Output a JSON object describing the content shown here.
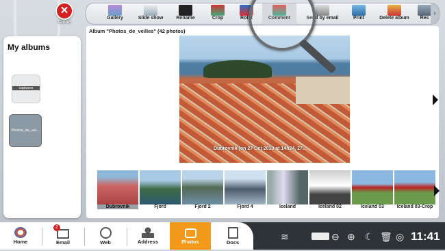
{
  "close": {
    "label": "Close"
  },
  "toolbar": {
    "tools": [
      {
        "label": "Gallery"
      },
      {
        "label": "Slide show"
      },
      {
        "label": "Rename"
      },
      {
        "label": "Crop"
      },
      {
        "label": "Rotat"
      },
      {
        "label": "Comment"
      },
      {
        "label": "Send by email"
      },
      {
        "label": "Print"
      },
      {
        "label": "Delete album"
      },
      {
        "label": "Res"
      }
    ]
  },
  "sidebar": {
    "title": "My albums",
    "albums": [
      {
        "label": "captures"
      },
      {
        "label": "Photos_de_vei..."
      }
    ]
  },
  "main": {
    "album_title": "Album \"Photos_de_veilles\" (42 photos)",
    "photo_caption": "Dubrovnik (on 27 Oct 2010 at 14h24, 27...",
    "thumbnails": [
      {
        "label": "Dubrovnik"
      },
      {
        "label": "Fjord"
      },
      {
        "label": "Fjord 2"
      },
      {
        "label": "Fjord 4"
      },
      {
        "label": "Iceland"
      },
      {
        "label": "Iceland 02"
      },
      {
        "label": "Iceland 03"
      },
      {
        "label": "Iceland 03-Crop"
      }
    ]
  },
  "dock": {
    "apps": [
      {
        "label": "Home"
      },
      {
        "label": "Email"
      },
      {
        "label": "Web"
      },
      {
        "label": "Address"
      },
      {
        "label": "Photos"
      },
      {
        "label": "Docs"
      }
    ],
    "email_badge": "2",
    "clock": "11:41"
  },
  "colors": {
    "accent": "#f39a1d",
    "close": "#d42020",
    "dock": "#2e3338"
  }
}
